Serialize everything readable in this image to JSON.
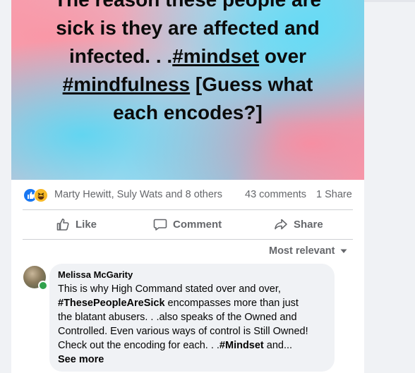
{
  "post": {
    "banner": {
      "line1": "The reason these people are",
      "line2": "sick is they are affected and",
      "line3_prefix": "infected. . .",
      "tag_mindset": "#mindset",
      "line3_suffix": " over",
      "tag_mindfulness": "#mindfulness",
      "line4_suffix": " [Guess what",
      "line5": "each encodes?]"
    },
    "stats": {
      "reactors": "Marty Hewitt, Suly Wats and 8 others",
      "comments": "43 comments",
      "shares": "1 Share"
    },
    "actions": {
      "like": "Like",
      "comment": "Comment",
      "share": "Share"
    },
    "sort_label": "Most relevant"
  },
  "comment": {
    "author": "Melissa McGarity",
    "line1": "This is why High Command stated over and over,",
    "tag": "#ThesePeopleAreSick",
    "line2_suffix": " encompasses more than just",
    "line3": "the blatant abusers. . .also speaks of the Owned and",
    "line4": "Controlled. Even various ways of control is Still Owned!",
    "line5_prefix": "Check out the encoding for each. . .",
    "tag2": "#Mindset",
    "line5_suffix": " and...",
    "see_more": "See more"
  },
  "colors": {
    "accent": "#1877f2",
    "muted_text": "#65676b",
    "online": "#31a24c"
  },
  "icons": [
    "like-reaction-icon",
    "haha-reaction-icon",
    "thumbs-up-icon",
    "comment-icon",
    "share-icon",
    "chevron-down-icon"
  ]
}
